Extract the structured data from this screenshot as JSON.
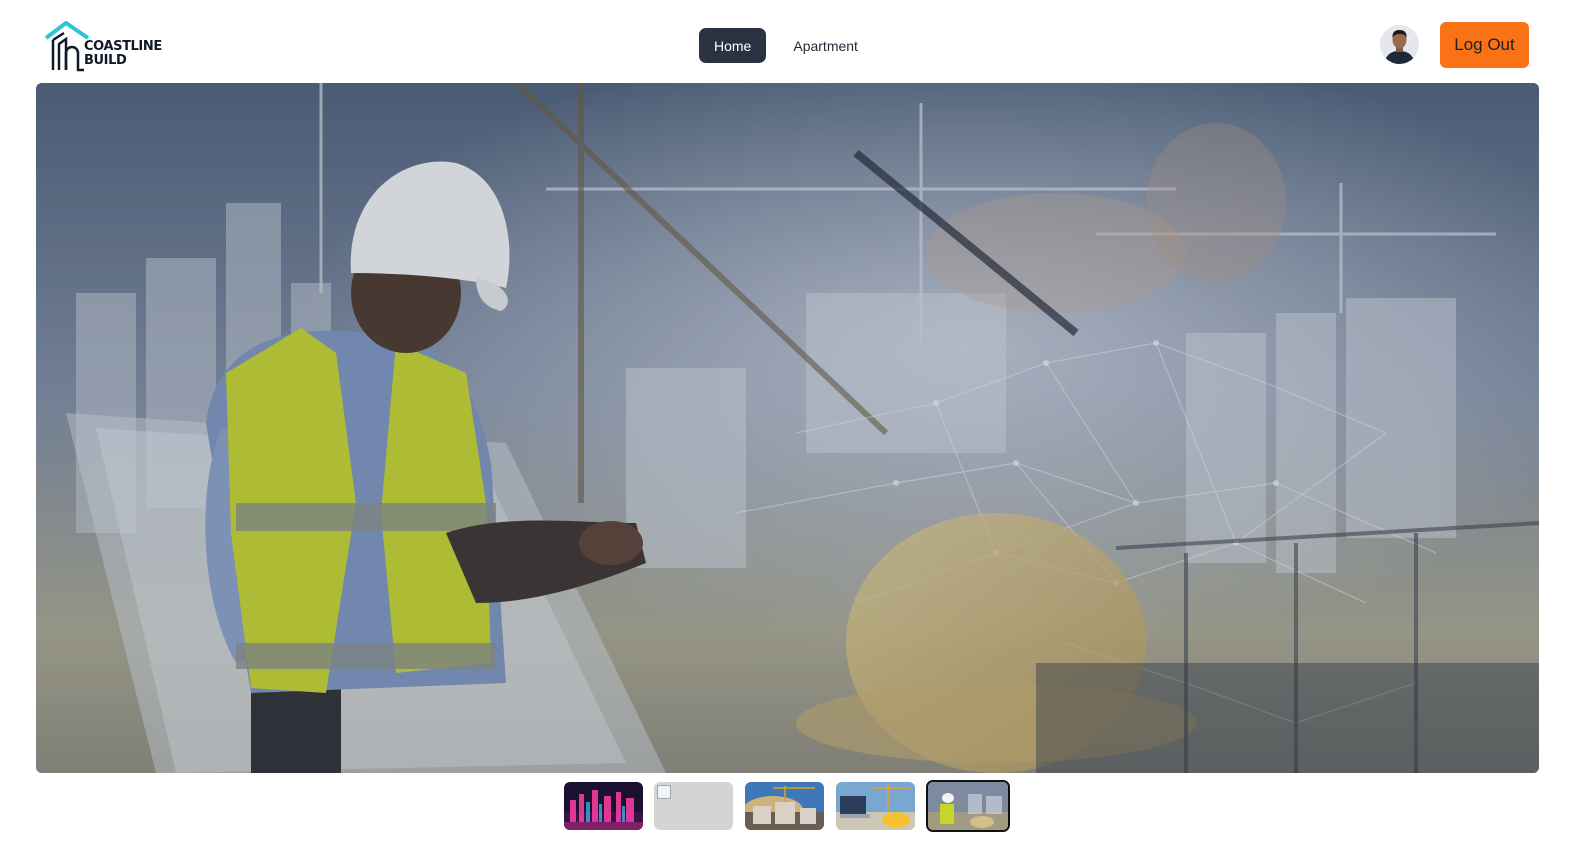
{
  "brand": {
    "line1": "COASTLINE",
    "line2": "BUILD",
    "accent_color": "#2ec4d6"
  },
  "nav": {
    "items": [
      {
        "label": "Home",
        "active": true
      },
      {
        "label": "Apartment",
        "active": false
      }
    ]
  },
  "user": {
    "avatar_icon": "user-avatar",
    "logout_label": "Log Out",
    "logout_color": "#f97316"
  },
  "hero": {
    "image": "construction-worker-double-exposure",
    "overlay_color": "#3c4b64"
  },
  "carousel": {
    "thumbnails": [
      {
        "image": "city-night-skyline",
        "active": false
      },
      {
        "image": "broken-image",
        "active": false
      },
      {
        "image": "building-site-sunset",
        "active": false
      },
      {
        "image": "hardhat-laptop-blueprints",
        "active": false
      },
      {
        "image": "worker-double-exposure",
        "active": true
      }
    ]
  }
}
